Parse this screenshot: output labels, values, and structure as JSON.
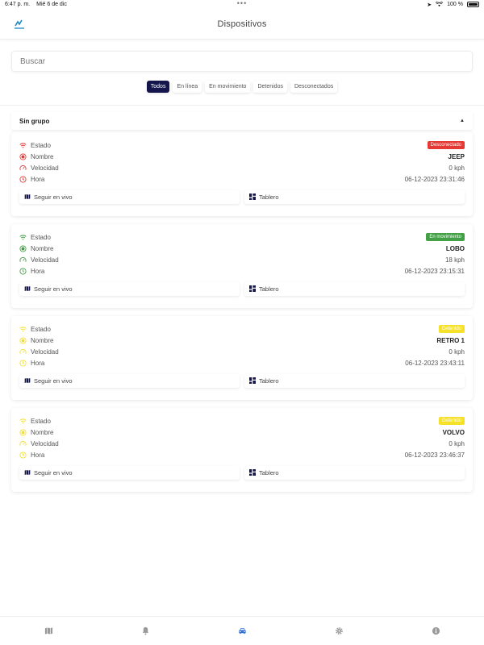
{
  "status_bar": {
    "time": "6:47 p. m.",
    "date": "Mié 6 de dic",
    "battery": "100 %"
  },
  "header": {
    "title": "Dispositivos"
  },
  "search": {
    "placeholder": "Buscar"
  },
  "filters": [
    {
      "label": "Todos",
      "active": true
    },
    {
      "label": "En línea",
      "active": false
    },
    {
      "label": "En movimiento",
      "active": false
    },
    {
      "label": "Detenidos",
      "active": false
    },
    {
      "label": "Desconectados",
      "active": false
    }
  ],
  "group": {
    "label": "Sin grupo"
  },
  "labels": {
    "estado": "Estado",
    "nombre": "Nombre",
    "velocidad": "Velocidad",
    "hora": "Hora",
    "follow": "Seguir en vivo",
    "dashboard": "Tablero"
  },
  "devices": [
    {
      "status": "Desconectado",
      "status_color": "#e53935",
      "name": "JEEP",
      "speed": "0 kph",
      "time": "06-12-2023 23:31:46"
    },
    {
      "status": "En movimiento",
      "status_color": "#43a047",
      "name": "LOBO",
      "speed": "18 kph",
      "time": "06-12-2023 23:15:31"
    },
    {
      "status": "Detenido",
      "status_color": "#f5e12a",
      "name": "RETRO 1",
      "speed": "0 kph",
      "time": "06-12-2023 23:43:11"
    },
    {
      "status": "Detenido",
      "status_color": "#f5e12a",
      "name": "VOLVO",
      "speed": "0 kph",
      "time": "06-12-2023 23:46:37"
    }
  ],
  "nav": [
    {
      "icon": "map-icon",
      "active": false
    },
    {
      "icon": "bell-icon",
      "active": false
    },
    {
      "icon": "car-icon",
      "active": true
    },
    {
      "icon": "gear-icon",
      "active": false
    },
    {
      "icon": "info-icon",
      "active": false
    }
  ],
  "colors": {
    "accent": "#14164b",
    "nav_active": "#2f6fd6",
    "nav_inactive": "#999999"
  }
}
